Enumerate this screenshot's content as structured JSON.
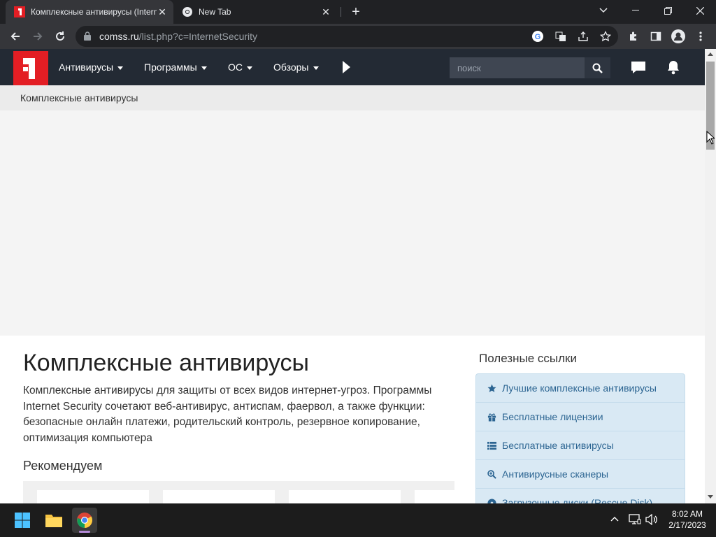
{
  "browser": {
    "tabs": [
      {
        "title": "Комплексные антивирусы (Internet Security)",
        "active": true
      },
      {
        "title": "New Tab",
        "active": false
      }
    ],
    "url_host": "comss.ru",
    "url_path": "/list.php?c=InternetSecurity"
  },
  "site": {
    "logo_text": "1",
    "nav": [
      {
        "label": "Антивирусы"
      },
      {
        "label": "Программы"
      },
      {
        "label": "ОС"
      },
      {
        "label": "Обзоры"
      }
    ],
    "search_placeholder": "поиск",
    "breadcrumb": "Комплексные антивирусы",
    "page_title": "Комплексные антивирусы",
    "description": "Комплексные антивирусы для защиты от всех видов интернет-угроз. Программы Internet Security сочетают веб-антивирус, антиспам, фаервол, а также функции: безопасные онлайн платежи, родительский контроль, резервное копирование, оптимизация компьютера",
    "recommend_heading": "Рекомендуем",
    "sidebar_title": "Полезные ссылки",
    "sidebar_links": [
      {
        "label": "Лучшие комплексные антивирусы",
        "icon": "star-icon"
      },
      {
        "label": "Бесплатные лицензии",
        "icon": "gift-icon"
      },
      {
        "label": "Бесплатные антивирусы",
        "icon": "list-icon"
      },
      {
        "label": "Антивирусные сканеры",
        "icon": "zoom-icon"
      },
      {
        "label": "Загрузочные диски (Rescue Disk)",
        "icon": "disk-icon"
      }
    ],
    "colors": {
      "header": "#232a34",
      "logo": "#e31e24",
      "link": "#2c6592"
    }
  },
  "taskbar": {
    "time": "8:02 AM",
    "date": "2/17/2023"
  }
}
